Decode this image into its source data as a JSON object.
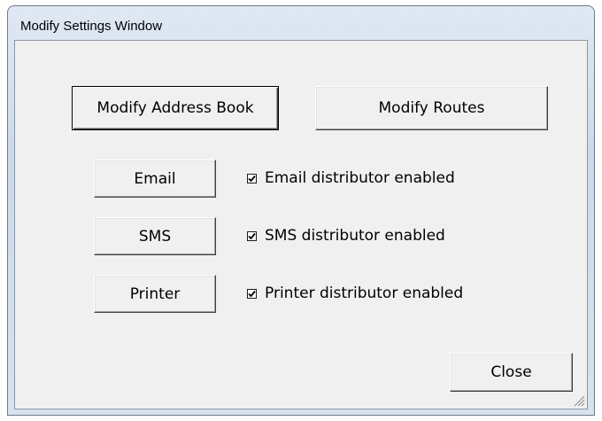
{
  "window": {
    "title": "Modify Settings Window"
  },
  "top_buttons": {
    "address_book": "Modify Address Book",
    "routes": "Modify Routes"
  },
  "distributors": [
    {
      "button": "Email",
      "checkbox_label": "Email distributor enabled",
      "checked": true
    },
    {
      "button": "SMS",
      "checkbox_label": "SMS distributor enabled",
      "checked": true
    },
    {
      "button": "Printer",
      "checkbox_label": "Printer distributor enabled",
      "checked": true
    }
  ],
  "close_label": "Close"
}
